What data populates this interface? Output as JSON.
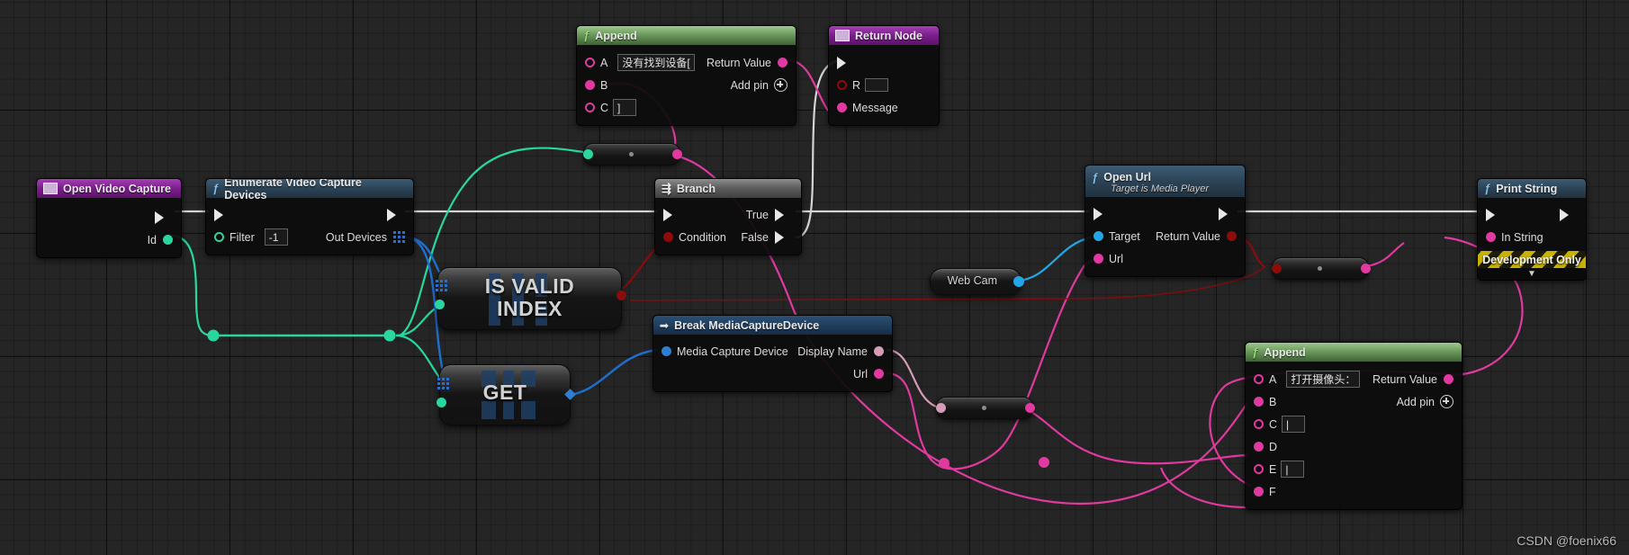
{
  "editor": {
    "name": "Unreal Engine Blueprint Event Graph",
    "watermark": "CSDN @foenix66",
    "grid_color": "#252525"
  },
  "nodes": {
    "open_video_capture": {
      "title": "Open Video Capture",
      "header_color": "#7b1f8d",
      "pins": {
        "out_id": "Id"
      }
    },
    "enumerate_video_capture_devices": {
      "title": "Enumerate Video Capture Devices",
      "header_color": "#2c4457",
      "pins": {
        "filter": "Filter",
        "out_devices": "Out Devices"
      },
      "values": {
        "filter": "-1"
      }
    },
    "is_valid_index": {
      "title_line1": "IS VALID",
      "title_line2": "INDEX"
    },
    "get_node": {
      "title": "GET"
    },
    "append_top": {
      "title": "Append",
      "header_color": "#6c9a5c",
      "pins": {
        "a": "A",
        "b": "B",
        "c": "C",
        "return_value": "Return Value",
        "add_pin": "Add pin"
      },
      "values": {
        "a": "没有找到设备[",
        "c": "]"
      }
    },
    "return_node": {
      "title": "Return Node",
      "header_color": "#7b1f8d",
      "pins": {
        "r": "R",
        "message": "Message"
      },
      "values": {
        "r": ""
      }
    },
    "branch": {
      "title": "Branch",
      "header_color": "#5d5d5d",
      "pins": {
        "condition": "Condition",
        "true": "True",
        "false": "False"
      }
    },
    "break_media_capture_device": {
      "title": "Break MediaCaptureDevice",
      "header_color": "#21405f",
      "pins": {
        "media_capture_device": "Media Capture Device",
        "display_name": "Display Name",
        "url": "Url"
      }
    },
    "web_cam": {
      "title": "Web Cam"
    },
    "open_url": {
      "title": "Open Url",
      "subtitle": "Target is Media Player",
      "header_color": "#2c4457",
      "pins": {
        "target": "Target",
        "url": "Url",
        "return_value": "Return Value"
      }
    },
    "append_bottom": {
      "title": "Append",
      "header_color": "#6c9a5c",
      "pins": {
        "a": "A",
        "b": "B",
        "c": "C",
        "d": "D",
        "e": "E",
        "f": "F",
        "return_value": "Return Value",
        "add_pin": "Add pin"
      },
      "values": {
        "a": "打开摄像头：",
        "c": "|",
        "e": "|"
      }
    },
    "print_string": {
      "title": "Print String",
      "header_color": "#2c4457",
      "pins": {
        "in_string": "In String"
      },
      "footer": "Development Only",
      "expand_icon": "chevron-down-icon"
    }
  },
  "reroutes": [
    {
      "name": "reroute-string-top",
      "in_color": "#2ad6a0",
      "out_color": "#e0399f"
    },
    {
      "name": "reroute-string-mid",
      "in_color": "#d59bb7",
      "out_color": "#e0399f"
    },
    {
      "name": "reroute-bool-right",
      "in_color": "#8c0b0b",
      "out_color": "#e0399f"
    }
  ],
  "wire_colors": {
    "exec": "#d4d4d4",
    "string": "#e0399f",
    "bool": "#8c0b0b",
    "int": "#2ad6a0",
    "object": "#23a6e8",
    "struct": "#1f6fd0",
    "string_pale": "#d59bb7"
  }
}
